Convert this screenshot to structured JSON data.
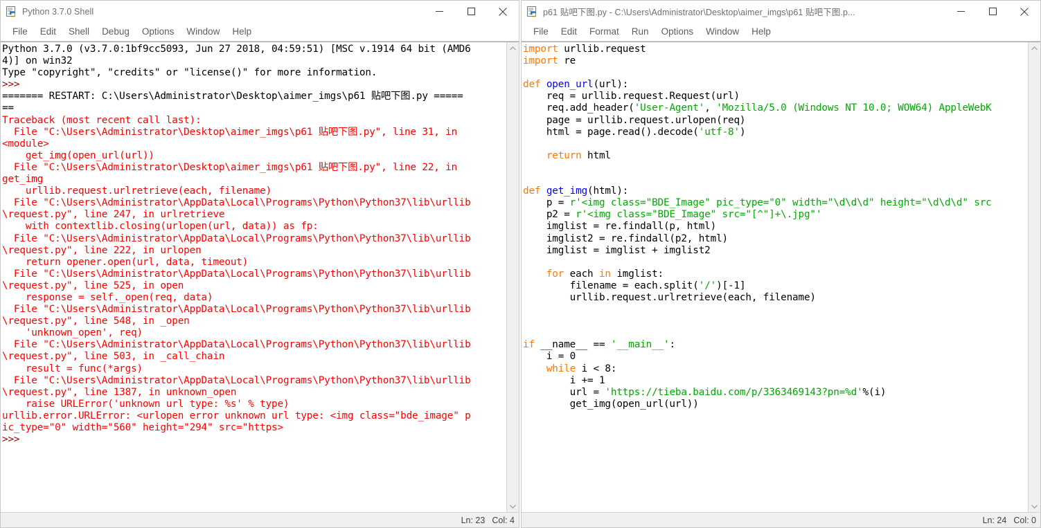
{
  "shell_window": {
    "title": "Python 3.7.0 Shell",
    "icon": "python-idle-icon",
    "menu": [
      "File",
      "Edit",
      "Shell",
      "Debug",
      "Options",
      "Window",
      "Help"
    ],
    "controls": {
      "minimize": "minimize-icon",
      "maximize": "maximize-icon",
      "close": "close-icon"
    },
    "status": {
      "line": "Ln: 23",
      "col": "Col: 4"
    },
    "content": [
      {
        "c": "plain",
        "t": "Python 3.7.0 (v3.7.0:1bf9cc5093, Jun 27 2018, 04:59:51) [MSC v.1914 64 bit (AMD6"
      },
      {
        "c": "plain",
        "t": "4)] on win32"
      },
      {
        "c": "plain",
        "t": "Type \"copyright\", \"credits\" or \"license()\" for more information."
      },
      {
        "c": "prompt",
        "t": ">>>"
      },
      {
        "c": "plain",
        "t": "======= RESTART: C:\\Users\\Administrator\\Desktop\\aimer_imgs\\p61 贴吧下图.py ====="
      },
      {
        "c": "plain",
        "t": "=="
      },
      {
        "c": "err",
        "t": "Traceback (most recent call last):"
      },
      {
        "c": "err",
        "t": "  File \"C:\\Users\\Administrator\\Desktop\\aimer_imgs\\p61 贴吧下图.py\", line 31, in"
      },
      {
        "c": "err",
        "t": "<module>"
      },
      {
        "c": "err",
        "t": "    get_img(open_url(url))"
      },
      {
        "c": "err",
        "t": "  File \"C:\\Users\\Administrator\\Desktop\\aimer_imgs\\p61 贴吧下图.py\", line 22, in"
      },
      {
        "c": "err",
        "t": "get_img"
      },
      {
        "c": "err",
        "t": "    urllib.request.urlretrieve(each, filename)"
      },
      {
        "c": "err",
        "t": "  File \"C:\\Users\\Administrator\\AppData\\Local\\Programs\\Python\\Python37\\lib\\urllib"
      },
      {
        "c": "err",
        "t": "\\request.py\", line 247, in urlretrieve"
      },
      {
        "c": "err",
        "t": "    with contextlib.closing(urlopen(url, data)) as fp:"
      },
      {
        "c": "err",
        "t": "  File \"C:\\Users\\Administrator\\AppData\\Local\\Programs\\Python\\Python37\\lib\\urllib"
      },
      {
        "c": "err",
        "t": "\\request.py\", line 222, in urlopen"
      },
      {
        "c": "err",
        "t": "    return opener.open(url, data, timeout)"
      },
      {
        "c": "err",
        "t": "  File \"C:\\Users\\Administrator\\AppData\\Local\\Programs\\Python\\Python37\\lib\\urllib"
      },
      {
        "c": "err",
        "t": "\\request.py\", line 525, in open"
      },
      {
        "c": "err",
        "t": "    response = self._open(req, data)"
      },
      {
        "c": "err",
        "t": "  File \"C:\\Users\\Administrator\\AppData\\Local\\Programs\\Python\\Python37\\lib\\urllib"
      },
      {
        "c": "err",
        "t": "\\request.py\", line 548, in _open"
      },
      {
        "c": "err",
        "t": "    'unknown_open', req)"
      },
      {
        "c": "err",
        "t": "  File \"C:\\Users\\Administrator\\AppData\\Local\\Programs\\Python\\Python37\\lib\\urllib"
      },
      {
        "c": "err",
        "t": "\\request.py\", line 503, in _call_chain"
      },
      {
        "c": "err",
        "t": "    result = func(*args)"
      },
      {
        "c": "err",
        "t": "  File \"C:\\Users\\Administrator\\AppData\\Local\\Programs\\Python\\Python37\\lib\\urllib"
      },
      {
        "c": "err",
        "t": "\\request.py\", line 1387, in unknown_open"
      },
      {
        "c": "err",
        "t": "    raise URLError('unknown url type: %s' % type)"
      },
      {
        "c": "err",
        "t": "urllib.error.URLError: <urlopen error unknown url type: <img class=\"bde_image\" p"
      },
      {
        "c": "err",
        "t": "ic_type=\"0\" width=\"560\" height=\"294\" src=\"https>"
      },
      {
        "c": "prompt",
        "t": ">>>"
      }
    ]
  },
  "editor_window": {
    "title": "p61 贴吧下图.py - C:\\Users\\Administrator\\Desktop\\aimer_imgs\\p61 贴吧下图.p...",
    "icon": "python-idle-icon",
    "menu": [
      "File",
      "Edit",
      "Format",
      "Run",
      "Options",
      "Window",
      "Help"
    ],
    "controls": {
      "minimize": "minimize-icon",
      "maximize": "maximize-icon",
      "close": "close-icon"
    },
    "status": {
      "line": "Ln: 24",
      "col": "Col: 0"
    },
    "code": [
      [
        {
          "c": "kw",
          "t": "import"
        },
        {
          "c": "plain",
          "t": " urllib.request"
        }
      ],
      [
        {
          "c": "kw",
          "t": "import"
        },
        {
          "c": "plain",
          "t": " re"
        }
      ],
      [
        {
          "c": "plain",
          "t": ""
        }
      ],
      [
        {
          "c": "kw",
          "t": "def"
        },
        {
          "c": "plain",
          "t": " "
        },
        {
          "c": "defname",
          "t": "open_url"
        },
        {
          "c": "plain",
          "t": "(url):"
        }
      ],
      [
        {
          "c": "plain",
          "t": "    req = urllib.request.Request(url)"
        }
      ],
      [
        {
          "c": "plain",
          "t": "    req.add_header("
        },
        {
          "c": "str",
          "t": "'User-Agent'"
        },
        {
          "c": "plain",
          "t": ", "
        },
        {
          "c": "str",
          "t": "'Mozilla/5.0 (Windows NT 10.0; WOW64) AppleWebK"
        }
      ],
      [
        {
          "c": "plain",
          "t": "    page = urllib.request.urlopen(req)"
        }
      ],
      [
        {
          "c": "plain",
          "t": "    html = page.read().decode("
        },
        {
          "c": "str",
          "t": "'utf-8'"
        },
        {
          "c": "plain",
          "t": ")"
        }
      ],
      [
        {
          "c": "plain",
          "t": ""
        }
      ],
      [
        {
          "c": "plain",
          "t": "    "
        },
        {
          "c": "kw",
          "t": "return"
        },
        {
          "c": "plain",
          "t": " html"
        }
      ],
      [
        {
          "c": "plain",
          "t": ""
        }
      ],
      [
        {
          "c": "plain",
          "t": ""
        }
      ],
      [
        {
          "c": "kw",
          "t": "def"
        },
        {
          "c": "plain",
          "t": " "
        },
        {
          "c": "defname",
          "t": "get_img"
        },
        {
          "c": "plain",
          "t": "(html):"
        }
      ],
      [
        {
          "c": "plain",
          "t": "    p = "
        },
        {
          "c": "str",
          "t": "r'<img class=\"BDE_Image\" pic_type=\"0\" width=\"\\d\\d\\d\" height=\"\\d\\d\\d\" src"
        }
      ],
      [
        {
          "c": "plain",
          "t": "    p2 = "
        },
        {
          "c": "str",
          "t": "r'<img class=\"BDE_Image\" src=\"[^\"]+\\.jpg\"'"
        }
      ],
      [
        {
          "c": "plain",
          "t": "    imglist = re.findall(p, html)"
        }
      ],
      [
        {
          "c": "plain",
          "t": "    imglist2 = re.findall(p2, html)"
        }
      ],
      [
        {
          "c": "plain",
          "t": "    imglist = imglist + imglist2"
        }
      ],
      [
        {
          "c": "plain",
          "t": ""
        }
      ],
      [
        {
          "c": "plain",
          "t": "    "
        },
        {
          "c": "kw",
          "t": "for"
        },
        {
          "c": "plain",
          "t": " each "
        },
        {
          "c": "kw",
          "t": "in"
        },
        {
          "c": "plain",
          "t": " imglist:"
        }
      ],
      [
        {
          "c": "plain",
          "t": "        filename = each.split("
        },
        {
          "c": "str",
          "t": "'/'"
        },
        {
          "c": "plain",
          "t": ")[-1]"
        }
      ],
      [
        {
          "c": "plain",
          "t": "        urllib.request.urlretrieve(each, filename)"
        }
      ],
      [
        {
          "c": "plain",
          "t": ""
        }
      ],
      [
        {
          "c": "plain",
          "t": ""
        }
      ],
      [
        {
          "c": "plain",
          "t": ""
        }
      ],
      [
        {
          "c": "kw",
          "t": "if"
        },
        {
          "c": "plain",
          "t": " __name__ == "
        },
        {
          "c": "str",
          "t": "'__main__'"
        },
        {
          "c": "plain",
          "t": ":"
        }
      ],
      [
        {
          "c": "plain",
          "t": "    i = 0"
        }
      ],
      [
        {
          "c": "plain",
          "t": "    "
        },
        {
          "c": "kw",
          "t": "while"
        },
        {
          "c": "plain",
          "t": " i < 8:"
        }
      ],
      [
        {
          "c": "plain",
          "t": "        i += 1"
        }
      ],
      [
        {
          "c": "plain",
          "t": "        url = "
        },
        {
          "c": "str",
          "t": "'https://tieba.baidu.com/p/3363469143?pn=%d'"
        },
        {
          "c": "plain",
          "t": "%(i)"
        }
      ],
      [
        {
          "c": "plain",
          "t": "        get_img(open_url(url))"
        }
      ]
    ]
  },
  "colors": {
    "keyword": "#ff7700",
    "definition": "#0000ff",
    "string": "#00aa00",
    "error": "#ff0000",
    "prompt": "#990000",
    "titlebar_text": "#6f6f6f",
    "menu_text": "#5e5e5e"
  }
}
